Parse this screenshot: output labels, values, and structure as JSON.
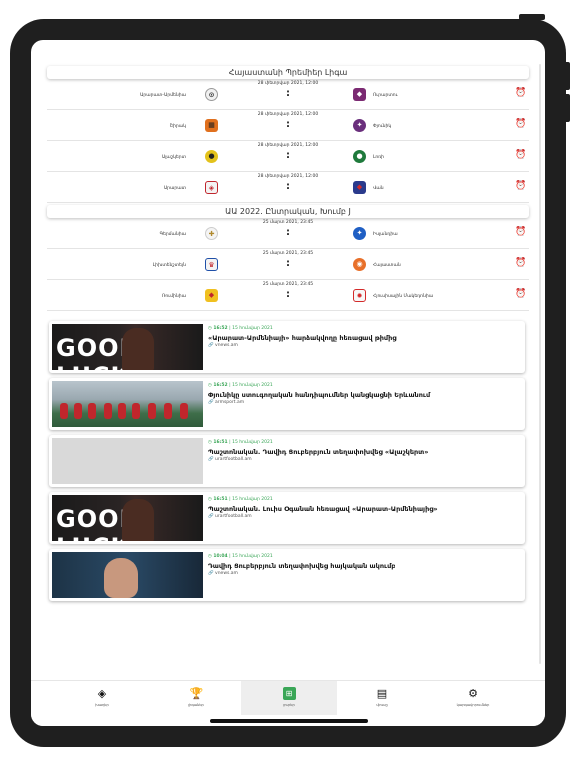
{
  "leagues": [
    {
      "name": "Հայաստանի Պրեմիեր Լիգա",
      "matches": [
        {
          "date": "28 փետրվար 2021, 12:00",
          "score": ":",
          "home": "Արարատ-Արմենիա",
          "away": "Ուրարտու",
          "home_logo": "ararat-armenia-logo",
          "away_logo": "urartu-logo"
        },
        {
          "date": "28 փետրվար 2021, 12:00",
          "score": ":",
          "home": "Շիրակ",
          "away": "Փյունիկ",
          "home_logo": "shirak-logo",
          "away_logo": "pyunik-logo"
        },
        {
          "date": "28 փետրվար 2021, 12:00",
          "score": ":",
          "home": "Ալաշկերտ",
          "away": "Լոռի",
          "home_logo": "alashkert-logo",
          "away_logo": "lori-logo"
        },
        {
          "date": "28 փետրվար 2021, 12:00",
          "score": ":",
          "home": "Արարատ",
          "away": "Վան",
          "home_logo": "ararat-logo",
          "away_logo": "van-logo"
        }
      ]
    },
    {
      "name": "ԱԱ 2022. Ընտրական, Խումբ J",
      "matches": [
        {
          "date": "25 մարտ 2021, 23:45",
          "score": ":",
          "home": "Գերմանիա",
          "away": "Իսլանդիա",
          "home_logo": "germany-logo",
          "away_logo": "iceland-logo"
        },
        {
          "date": "25 մարտ 2021, 23:45",
          "score": ":",
          "home": "Լիխտենշտեյն",
          "away": "Հայաստան",
          "home_logo": "liechtenstein-logo",
          "away_logo": "armenia-logo"
        },
        {
          "date": "25 մարտ 2021, 23:45",
          "score": ":",
          "home": "Ռումինիա",
          "away": "Հյուսիսային Մակեդոնիա",
          "home_logo": "romania-logo",
          "away_logo": "north-macedonia-logo"
        }
      ]
    }
  ],
  "news": [
    {
      "time": "16:52",
      "date": "15 հունվար 2021",
      "title": "«Արարատ-Արմենիայի» հարձակվողը հեռացավ թիմից",
      "source": "vnews.am",
      "image": "good-luck-player"
    },
    {
      "time": "16:52",
      "date": "15 հունվար 2021",
      "title": "Փյունիկը ստուգողական հանդիպումներ կանցկացնի Երևանում",
      "source": "armsport.am",
      "image": "team-lineup"
    },
    {
      "time": "16:51",
      "date": "15 հունվար 2021",
      "title": "Պաշտոնական. Դավիդ Ցուբերբյուն տեղափոխվեց «Ալաշկերտ»",
      "source": "urartfootball.am",
      "image": "placeholder"
    },
    {
      "time": "16:51",
      "date": "15 հունվար 2021",
      "title": "Պաշտոնական. Լուիս Օգանան հեռացավ «Արարատ-Արմենիայից»",
      "source": "urartfootball.am",
      "image": "good-luck-player"
    },
    {
      "time": "10:04",
      "date": "15 հունվար 2021",
      "title": "Դավիդ Ցուբերբյուն տեղափոխվեց հայկական ակումբ",
      "source": "vnews.am",
      "image": "player-portrait"
    }
  ],
  "tabs": [
    {
      "label": "խաղեր",
      "icon": "ball-icon"
    },
    {
      "label": "լիգաներ",
      "icon": "trophy-icon"
    },
    {
      "label": "լուրեր",
      "icon": "field-icon",
      "active": true
    },
    {
      "label": "մյուսը",
      "icon": "document-icon"
    },
    {
      "label": "կարգավորումներ",
      "icon": "gear-icon"
    }
  ],
  "colors": {
    "accent": "#3aa657",
    "text": "#111111"
  }
}
